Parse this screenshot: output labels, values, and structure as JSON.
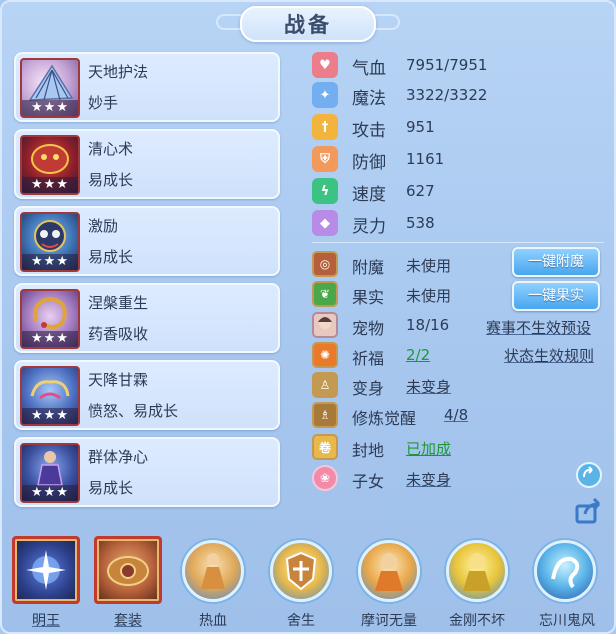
{
  "title": "战备",
  "skills": [
    {
      "name": "天地护法",
      "sub": "妙手",
      "stars": "★★★",
      "icon": "fan-feather-icon",
      "color": "#c9a7d6"
    },
    {
      "name": "清心术",
      "sub": "易成长",
      "stars": "★★★",
      "icon": "dragon-mask-icon",
      "color": "#8b2a2a"
    },
    {
      "name": "激励",
      "sub": "易成长",
      "stars": "★★★",
      "icon": "demon-mask-icon",
      "color": "#3d6fb0"
    },
    {
      "name": "涅槃重生",
      "sub": "药香吸收",
      "stars": "★★★",
      "icon": "serpent-ring-icon",
      "color": "#8a5a9a"
    },
    {
      "name": "天降甘霖",
      "sub": "愤怒、易成长",
      "stars": "★★★",
      "icon": "cloud-spiral-icon",
      "color": "#4c6fc0"
    },
    {
      "name": "群体净心",
      "sub": "易成长",
      "stars": "★★★",
      "icon": "guardian-figure-icon",
      "color": "#3a4f9e"
    }
  ],
  "stats": [
    {
      "label": "气血",
      "value": "7951/7951",
      "icon": "heart-icon",
      "color": "#ec7d8a"
    },
    {
      "label": "魔法",
      "value": "3322/3322",
      "icon": "mana-crystal-icon",
      "color": "#73aef0"
    },
    {
      "label": "攻击",
      "value": "951",
      "icon": "sword-icon",
      "color": "#f2b43c"
    },
    {
      "label": "防御",
      "value": "1161",
      "icon": "shield-icon",
      "color": "#f29a5c"
    },
    {
      "label": "速度",
      "value": "627",
      "icon": "lightning-icon",
      "color": "#3cc282"
    },
    {
      "label": "灵力",
      "value": "538",
      "icon": "spirit-diamond-icon",
      "color": "#b88ce6"
    }
  ],
  "extras": [
    {
      "label": "附魔",
      "value": "未使用",
      "icon": "enchant-scroll-icon"
    },
    {
      "label": "果实",
      "value": "未使用",
      "icon": "fruit-icon"
    },
    {
      "label": "宠物",
      "value": "18/16",
      "icon": "pet-portrait-icon"
    },
    {
      "label": "祈福",
      "value": "2/2",
      "icon": "blessing-orb-icon"
    },
    {
      "label": "变身",
      "value": "未变身",
      "icon": "transform-figure-icon"
    },
    {
      "label": "修炼觉醒",
      "value": "4/8",
      "icon": "awaken-figure-icon"
    },
    {
      "label": "封地",
      "value": "已加成",
      "icon": "fief-scroll-icon"
    },
    {
      "label": "子女",
      "value": "未变身",
      "icon": "lotus-icon"
    }
  ],
  "buttons": {
    "enchant": "一键附魔",
    "fruit": "一键果实"
  },
  "links": {
    "event_preset": "赛事不生效预设",
    "status_rules": "状态生效规则"
  },
  "bottom_skills": [
    {
      "label": "明王",
      "icon": "star-orb-icon"
    },
    {
      "label": "套装",
      "icon": "armor-set-icon"
    },
    {
      "label": "热血",
      "icon": "warrior-icon"
    },
    {
      "label": "舍生",
      "icon": "cross-shield-icon"
    },
    {
      "label": "摩诃无量",
      "icon": "monk-icon"
    },
    {
      "label": "金刚不坏",
      "icon": "golden-monk-icon"
    },
    {
      "label": "忘川鬼风",
      "icon": "ghost-wind-icon"
    }
  ]
}
